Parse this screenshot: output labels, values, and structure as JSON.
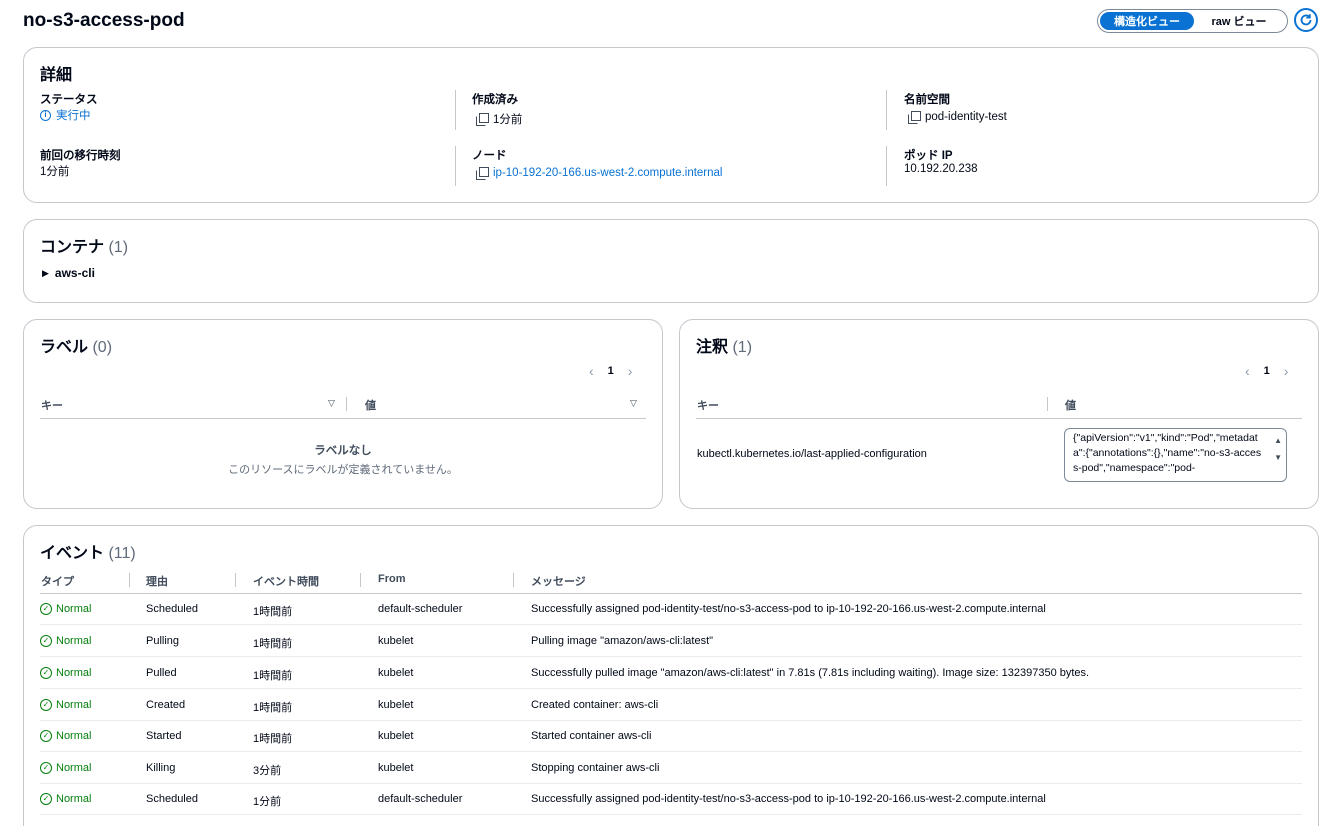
{
  "page": {
    "title": "no-s3-access-pod"
  },
  "view_toggle": {
    "structured": "構造化ビュー",
    "raw": "raw ビュー"
  },
  "details": {
    "title": "詳細",
    "status_label": "ステータス",
    "status_value": "実行中",
    "created_label": "作成済み",
    "created_value": "1分前",
    "namespace_label": "名前空間",
    "namespace_value": "pod-identity-test",
    "last_transition_label": "前回の移行時刻",
    "last_transition_value": "1分前",
    "node_label": "ノード",
    "node_value": "ip-10-192-20-166.us-west-2.compute.internal",
    "pod_ip_label": "ポッド IP",
    "pod_ip_value": "10.192.20.238"
  },
  "containers": {
    "title": "コンテナ",
    "count": "(1)",
    "items": [
      "aws-cli"
    ]
  },
  "labels": {
    "title": "ラベル",
    "count": "(0)",
    "page": "1",
    "col_key": "キー",
    "col_value": "値",
    "empty_title": "ラベルなし",
    "empty_desc": "このリソースにラベルが定義されていません。"
  },
  "annotations": {
    "title": "注釈",
    "count": "(1)",
    "page": "1",
    "col_key": "キー",
    "col_value": "値",
    "rows": [
      {
        "key": "kubectl.kubernetes.io/last-applied-configuration",
        "value": "{\"apiVersion\":\"v1\",\"kind\":\"Pod\",\"metadata\":{\"annotations\":{},\"name\":\"no-s3-access-pod\",\"namespace\":\"pod-"
      }
    ]
  },
  "events": {
    "title": "イベント",
    "count": "(11)",
    "columns": {
      "type": "タイプ",
      "reason": "理由",
      "time": "イベント時間",
      "from": "From",
      "message": "メッセージ"
    },
    "rows": [
      {
        "type": "Normal",
        "reason": "Scheduled",
        "time": "1時間前",
        "from": "default-scheduler",
        "message": "Successfully assigned pod-identity-test/no-s3-access-pod to ip-10-192-20-166.us-west-2.compute.internal"
      },
      {
        "type": "Normal",
        "reason": "Pulling",
        "time": "1時間前",
        "from": "kubelet",
        "message": "Pulling image \"amazon/aws-cli:latest\""
      },
      {
        "type": "Normal",
        "reason": "Pulled",
        "time": "1時間前",
        "from": "kubelet",
        "message": "Successfully pulled image \"amazon/aws-cli:latest\" in 7.81s (7.81s including waiting). Image size: 132397350 bytes."
      },
      {
        "type": "Normal",
        "reason": "Created",
        "time": "1時間前",
        "from": "kubelet",
        "message": "Created container: aws-cli"
      },
      {
        "type": "Normal",
        "reason": "Started",
        "time": "1時間前",
        "from": "kubelet",
        "message": "Started container aws-cli"
      },
      {
        "type": "Normal",
        "reason": "Killing",
        "time": "3分前",
        "from": "kubelet",
        "message": "Stopping container aws-cli"
      },
      {
        "type": "Normal",
        "reason": "Scheduled",
        "time": "1分前",
        "from": "default-scheduler",
        "message": "Successfully assigned pod-identity-test/no-s3-access-pod to ip-10-192-20-166.us-west-2.compute.internal"
      }
    ]
  },
  "colors": {
    "accent": "#0972d3",
    "success": "#037f0c",
    "border": "#c6c6cd"
  }
}
